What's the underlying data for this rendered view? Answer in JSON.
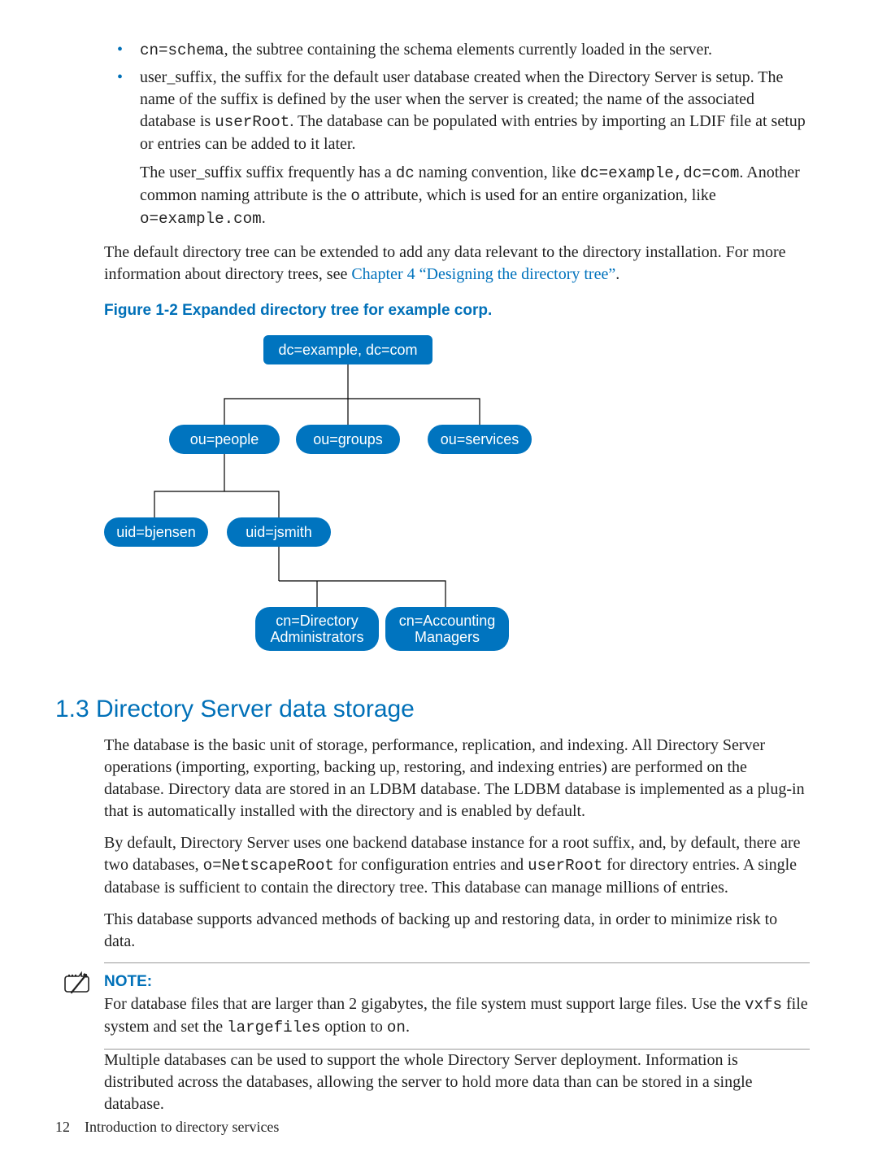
{
  "bullets": [
    {
      "lead_code": "cn=schema",
      "lead_text": ", the subtree containing the schema elements currently loaded in the server."
    },
    {
      "lead_text_1": "user_suffix, the suffix for the default user database created when the Directory Server is setup. The name of the suffix is defined by the user when the server is created; the name of the associated database is ",
      "code_1": "userRoot",
      "lead_text_2": ". The database can be populated with entries by importing an LDIF file at setup or entries can be added to it later.",
      "sub_1": "The user_suffix suffix frequently has a ",
      "sub_code_1": "dc",
      "sub_2": " naming convention, like ",
      "sub_code_2": "dc=example,dc=com",
      "sub_3": ". Another common naming attribute is the ",
      "sub_code_3": "o",
      "sub_4": " attribute, which is used for an entire organization, like ",
      "sub_code_4": "o=example.com",
      "sub_5": "."
    }
  ],
  "after_bullets_1": "The default directory tree can be extended to add any data relevant to the directory installation. For more information about directory trees, see ",
  "after_bullets_link": "Chapter 4 “Designing the directory tree”",
  "after_bullets_2": ".",
  "figure_caption": "Figure 1-2 Expanded directory tree for example corp.",
  "diagram": {
    "root": "dc=example, dc=com",
    "level2": [
      "ou=people",
      "ou=groups",
      "ou=services"
    ],
    "level3": [
      "uid=bjensen",
      "uid=jsmith"
    ],
    "level4_a": [
      "cn=Directory",
      "Administrators"
    ],
    "level4_b": [
      "cn=Accounting",
      "Managers"
    ]
  },
  "section_heading": "1.3 Directory Server data storage",
  "para1": "The database is the basic unit of storage, performance, replication, and indexing. All Directory Server operations (importing, exporting, backing up, restoring, and indexing entries) are performed on the database. Directory data are stored in an LDBM database. The LDBM database is implemented as a plug-in that is automatically installed with the directory and is enabled by default.",
  "para2_a": "By default, Directory Server uses one backend database instance for a root suffix, and, by default, there are two databases, ",
  "para2_code1": "o=NetscapeRoot",
  "para2_b": " for configuration entries and ",
  "para2_code2": "userRoot",
  "para2_c": " for directory entries. A single database is sufficient to contain the directory tree. This database can manage millions of entries.",
  "para3": "This database supports advanced methods of backing up and restoring data, in order to minimize risk to data.",
  "note_label": "NOTE:",
  "note_a": "For database files that are larger than 2 gigabytes, the file system must support large files. Use the ",
  "note_code1": "vxfs",
  "note_b": " file system and set the ",
  "note_code2": "largefiles",
  "note_c": " option to ",
  "note_code3": "on",
  "note_d": ".",
  "after_note": "Multiple databases can be used to support the whole Directory Server deployment. Information is distributed across the databases, allowing the server to hold more data than can be stored in a single database.",
  "footer_page": "12",
  "footer_title": "Introduction to directory services"
}
